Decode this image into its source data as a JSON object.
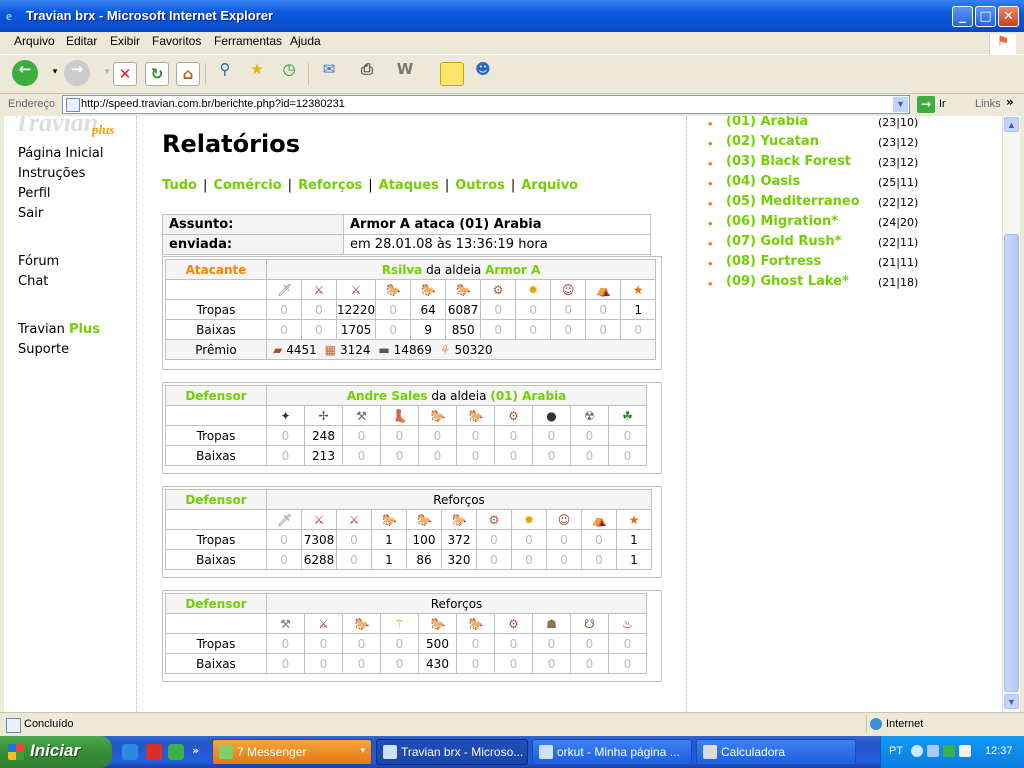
{
  "window": {
    "title": "Travian brx - Microsoft Internet Explorer",
    "buttons": [
      "_",
      "□",
      "✕"
    ]
  },
  "menu": [
    "Arquivo",
    "Editar",
    "Exibir",
    "Favoritos",
    "Ferramentas",
    "Ajuda"
  ],
  "address": {
    "label": "Endereço",
    "url": "http://speed.travian.com.br/berichte.php?id=12380231",
    "go": "Ir",
    "links": "Links"
  },
  "nav": {
    "logo": "Travian",
    "logo_plus": "plus",
    "items": [
      "Página Inicial",
      "Instruções",
      "Perfil",
      "Sair"
    ],
    "items2": [
      "Fórum",
      "Chat"
    ],
    "plus_prefix": "Travian",
    "plus_word": "Plus",
    "support": "Suporte"
  },
  "page": {
    "title": "Relatórios",
    "tabs": [
      "Tudo",
      "Comércio",
      "Reforços",
      "Ataques",
      "Outros",
      "Arquivo"
    ],
    "subject_label": "Assunto:",
    "subject": "Armor A ataca (01) Arabia",
    "sent_label": "enviada:",
    "sent": "em 28.01.08 às 13:36:19 hora"
  },
  "attacker": {
    "role": "Atacante",
    "player": "Rsilva",
    "village_connector": "da aldeia",
    "village": "Armor A",
    "units": [
      "🗡",
      "⚔",
      "⚔",
      "🐎",
      "🐎",
      "🐎",
      "⚙",
      "✹",
      "☺",
      "⛺",
      "★"
    ],
    "troops_label": "Tropas",
    "troops": [
      "0",
      "0",
      "12220",
      "0",
      "64",
      "6087",
      "0",
      "0",
      "0",
      "0",
      "1"
    ],
    "losses_label": "Baixas",
    "losses": [
      "0",
      "0",
      "1705",
      "0",
      "9",
      "850",
      "0",
      "0",
      "0",
      "0",
      "0"
    ],
    "bounty_label": "Prêmio",
    "bounty": [
      "4451",
      "3124",
      "14869",
      "50320"
    ]
  },
  "defender1": {
    "role": "Defensor",
    "player": "Andre Sales",
    "village_connector": "da aldeia",
    "village": "(01) Arabia",
    "units": [
      "✦",
      "✢",
      "⚒",
      "👢",
      "🐎",
      "🐎",
      "⚙",
      "●",
      "☢",
      "☘"
    ],
    "troops_label": "Tropas",
    "troops": [
      "0",
      "248",
      "0",
      "0",
      "0",
      "0",
      "0",
      "0",
      "0",
      "0"
    ],
    "losses_label": "Baixas",
    "losses": [
      "0",
      "213",
      "0",
      "0",
      "0",
      "0",
      "0",
      "0",
      "0",
      "0"
    ]
  },
  "defender2": {
    "role": "Defensor",
    "header": "Reforços",
    "units": [
      "🗡",
      "⚔",
      "⚔",
      "🐎",
      "🐎",
      "🐎",
      "⚙",
      "✹",
      "☺",
      "⛺",
      "★"
    ],
    "troops_label": "Tropas",
    "troops": [
      "0",
      "7308",
      "0",
      "1",
      "100",
      "372",
      "0",
      "0",
      "0",
      "0",
      "1"
    ],
    "losses_label": "Baixas",
    "losses": [
      "0",
      "6288",
      "0",
      "1",
      "86",
      "320",
      "0",
      "0",
      "0",
      "0",
      "1"
    ]
  },
  "defender3": {
    "role": "Defensor",
    "header": "Reforços",
    "units": [
      "⚒",
      "⚔",
      "🐎",
      "⚚",
      "🐎",
      "🐎",
      "⚙",
      "☗",
      "☋",
      "♨"
    ],
    "troops_label": "Tropas",
    "troops": [
      "0",
      "0",
      "0",
      "0",
      "500",
      "0",
      "0",
      "0",
      "0",
      "0"
    ],
    "losses_label": "Baixas",
    "losses": [
      "0",
      "0",
      "0",
      "0",
      "430",
      "0",
      "0",
      "0",
      "0",
      "0"
    ]
  },
  "villages": [
    {
      "name": "(01) Arabia",
      "coord": "(23|10)"
    },
    {
      "name": "(02) Yucatan",
      "coord": "(23|12)"
    },
    {
      "name": "(03) Black Forest",
      "coord": "(23|12)"
    },
    {
      "name": "(04) Oasis",
      "coord": "(25|11)"
    },
    {
      "name": "(05) Mediterraneo",
      "coord": "(22|12)"
    },
    {
      "name": "(06) Migration*",
      "coord": "(24|20)"
    },
    {
      "name": "(07) Gold Rush*",
      "coord": "(22|11)"
    },
    {
      "name": "(08) Fortress",
      "coord": "(21|11)"
    },
    {
      "name": "(09) Ghost Lake*",
      "coord": "(21|18)"
    }
  ],
  "status": {
    "text": "Concluído",
    "zone": "Internet"
  },
  "taskbar": {
    "start": "Iniciar",
    "tasks": [
      "7 Messenger",
      "Travian brx - Microso...",
      "orkut - Minha página ...",
      "Calculadora"
    ],
    "lang": "PT",
    "clock": "12:37"
  },
  "colors": {
    "green": "#71D000",
    "orange": "#FF8000",
    "border": "#C0C0C0"
  }
}
